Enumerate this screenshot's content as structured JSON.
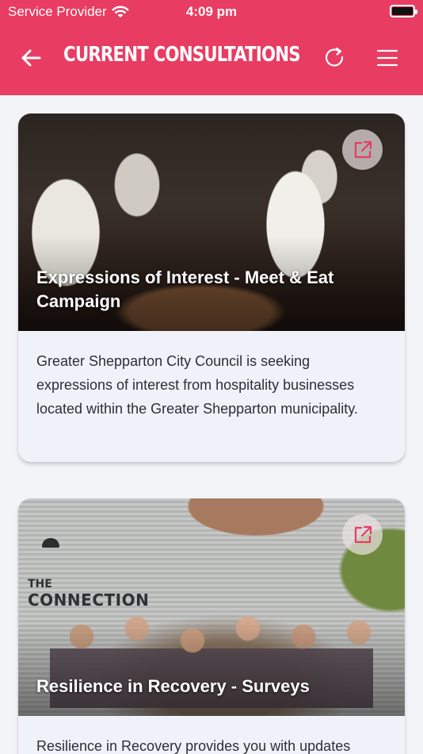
{
  "status_bar": {
    "carrier": "Service Provider",
    "time": "4:09 pm"
  },
  "header": {
    "title": "CURRENT CONSULTATIONS",
    "back_icon": "arrow-left-icon",
    "refresh_icon": "refresh-icon",
    "menu_icon": "hamburger-menu-icon"
  },
  "colors": {
    "accent": "#e83c62",
    "card_background": "#eff2f8",
    "page_background": "#f3f4f8"
  },
  "consultations": [
    {
      "title": "Expressions of Interest - Meet & Eat Campaign",
      "description": "Greater Shepparton City Council is seeking expressions of interest from hospitality businesses located within the Greater Shepparton municipality.",
      "link_icon": "external-link-icon"
    },
    {
      "title": "Resilience in Recovery - Surveys",
      "description": "Resilience in Recovery provides you with updates",
      "image_text": {
        "line1": "THE",
        "line2": "CONNECTION"
      },
      "link_icon": "external-link-icon"
    }
  ]
}
